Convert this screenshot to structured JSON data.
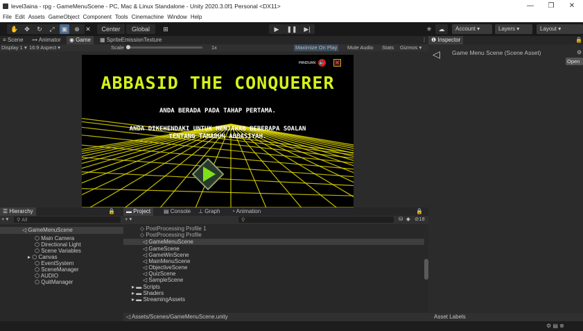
{
  "titlebar": {
    "title": "level3aina - rpg - GameMenuScene - PC, Mac & Linux Standalone - Unity 2020.3.0f1 Personal <DX11>",
    "minimize": "—",
    "maximize": "❐",
    "close": "✕"
  },
  "menubar": [
    "File",
    "Edit",
    "Assets",
    "GameObject",
    "Component",
    "Tools",
    "Cinemachine",
    "Window",
    "Help"
  ],
  "toolbar": {
    "center_label": "Center",
    "global_label": "Global",
    "account_label": "Account",
    "layers_label": "Layers",
    "layout_label": "Layout"
  },
  "scene_tabs": {
    "scene": "Scene",
    "animator": "Animator",
    "game": "Game",
    "sprite": "SpriteEmissionTexture"
  },
  "game_bar": {
    "display": "Display 1",
    "aspect": "16:9 Aspect",
    "scale_label": "Scale",
    "scale_value": "1x",
    "maximize": "Maximize On Play",
    "mute": "Mute Audio",
    "stats": "Stats",
    "gizmos": "Gizmos"
  },
  "game_view": {
    "title": "ABBASID THE CONQUERER",
    "line1": "ANDA BERADA PADA TAHAP PERTAMA.",
    "line2a": "ANDA DIKEHENDAKI UNTUK MENJAWAB BEBERAPA SOALAN",
    "line2b": "TENTANG TAMADUN ABBASIYAH.",
    "panduan": "PANDUAN",
    "title_color": "#d4f21a",
    "grid_color": "#e8e000"
  },
  "inspector": {
    "tab": "Inspector",
    "object": "Game Menu Scene (Scene Asset)",
    "open": "Open",
    "asset_labels": "Asset Labels"
  },
  "hierarchy": {
    "tab": "Hierarchy",
    "search": "All",
    "scene": "GameMenuScene",
    "items": [
      "Main Camera",
      "Directional Light",
      "Scene Variables",
      "Canvas",
      "EventSystem",
      "SceneManager",
      "AUDIO",
      "QuitManager"
    ]
  },
  "project": {
    "tabs": [
      "Project",
      "Console",
      "Graph",
      "Animation"
    ],
    "count": "18",
    "items": [
      "PostProcessing Profile 1",
      "PostProcessing Profile",
      "GameMenuScene",
      "GameScene",
      "GameWinScene",
      "MainMenuScene",
      "ObjectiveScene",
      "QuizScene",
      "SampleScene",
      "Scripts",
      "Shaders",
      "StreamingAssets"
    ],
    "path": "Assets/Scenes/GameMenuScene.unity"
  }
}
